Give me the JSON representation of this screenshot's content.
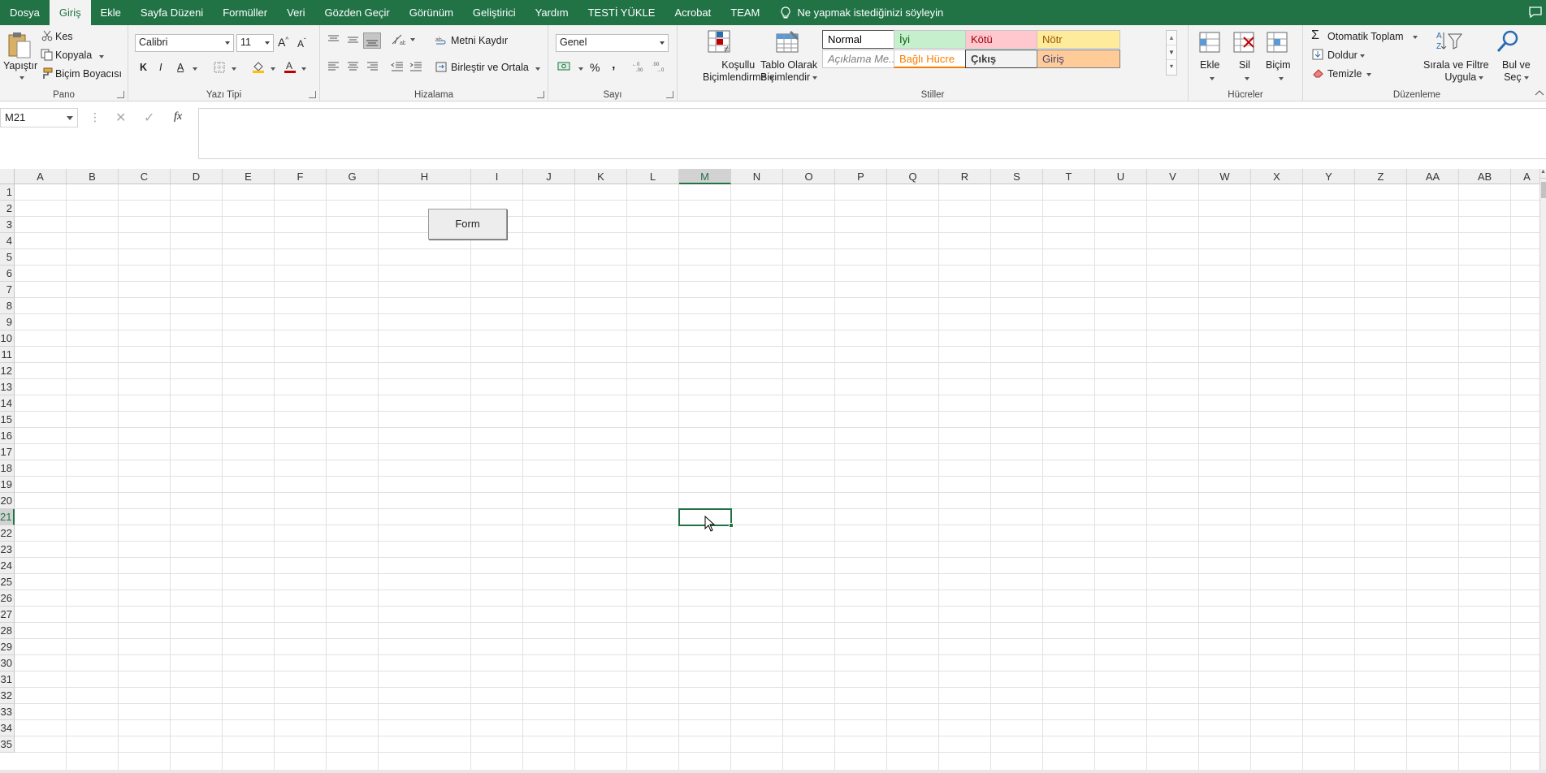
{
  "tabs": [
    {
      "label": "Dosya",
      "active": false
    },
    {
      "label": "Giriş",
      "active": true
    },
    {
      "label": "Ekle",
      "active": false
    },
    {
      "label": "Sayfa Düzeni",
      "active": false
    },
    {
      "label": "Formüller",
      "active": false
    },
    {
      "label": "Veri",
      "active": false
    },
    {
      "label": "Gözden Geçir",
      "active": false
    },
    {
      "label": "Görünüm",
      "active": false
    },
    {
      "label": "Geliştirici",
      "active": false
    },
    {
      "label": "Yardım",
      "active": false
    },
    {
      "label": "TESTİ YÜKLE",
      "active": false
    },
    {
      "label": "Acrobat",
      "active": false
    },
    {
      "label": "TEAM",
      "active": false
    }
  ],
  "tell_me": "Ne yapmak istediğinizi söyleyin",
  "ribbon": {
    "clipboard": {
      "paste": "Yapıştır",
      "cut": "Kes",
      "copy": "Kopyala",
      "format_painter": "Biçim Boyacısı",
      "label": "Pano"
    },
    "font": {
      "name": "Calibri",
      "size": "11",
      "bold": "K",
      "italic": "I",
      "underline": "A",
      "label": "Yazı Tipi"
    },
    "alignment": {
      "wrap": "Metni Kaydır",
      "merge": "Birleştir ve Ortala",
      "label": "Hizalama"
    },
    "number": {
      "format": "Genel",
      "percent": "%",
      "comma": "‚",
      "label": "Sayı"
    },
    "styles": {
      "conditional": [
        "Koşullu",
        "Biçimlendirme"
      ],
      "table": [
        "Tablo Olarak",
        "Biçimlendir"
      ],
      "cells": [
        {
          "label": "Normal",
          "bg": "#ffffff",
          "fg": "#000000"
        },
        {
          "label": "İyi",
          "bg": "#c6efce",
          "fg": "#006100"
        },
        {
          "label": "Kötü",
          "bg": "#ffc7ce",
          "fg": "#9c0006"
        },
        {
          "label": "Nötr",
          "bg": "#ffeb9c",
          "fg": "#9c5700"
        },
        {
          "label": "Açıklama Me...",
          "bg": "#ffffff",
          "fg": "#7f7f7f"
        },
        {
          "label": "Bağlı Hücre",
          "bg": "#ffffff",
          "fg": "#fa7d00"
        },
        {
          "label": "Çıkış",
          "bg": "#f2f2f2",
          "fg": "#3f3f3f"
        },
        {
          "label": "Giriş",
          "bg": "#ffcc99",
          "fg": "#3f3f76"
        }
      ],
      "label": "Stiller"
    },
    "cells": {
      "insert": "Ekle",
      "delete": "Sil",
      "format": "Biçim",
      "label": "Hücreler"
    },
    "editing": {
      "autosum": "Otomatik Toplam",
      "fill": "Doldur",
      "clear": "Temizle",
      "sort": [
        "Sırala ve Filtre",
        "Uygula"
      ],
      "find": [
        "Bul ve",
        "Seç"
      ],
      "label": "Düzenleme"
    }
  },
  "formula_bar": {
    "name_box": "M21",
    "fx": "fx",
    "value": ""
  },
  "grid": {
    "columns": [
      "A",
      "B",
      "C",
      "D",
      "E",
      "F",
      "G",
      "H",
      "I",
      "J",
      "K",
      "L",
      "M",
      "N",
      "O",
      "P",
      "Q",
      "R",
      "S",
      "T",
      "U",
      "V",
      "W",
      "X",
      "Y",
      "Z",
      "AA",
      "AB",
      "A"
    ],
    "selected_column": "M",
    "rows": 35,
    "selected_row": 21,
    "selected_cell": "M21"
  },
  "form_button": "Form",
  "colors": {
    "accent": "#217346"
  }
}
